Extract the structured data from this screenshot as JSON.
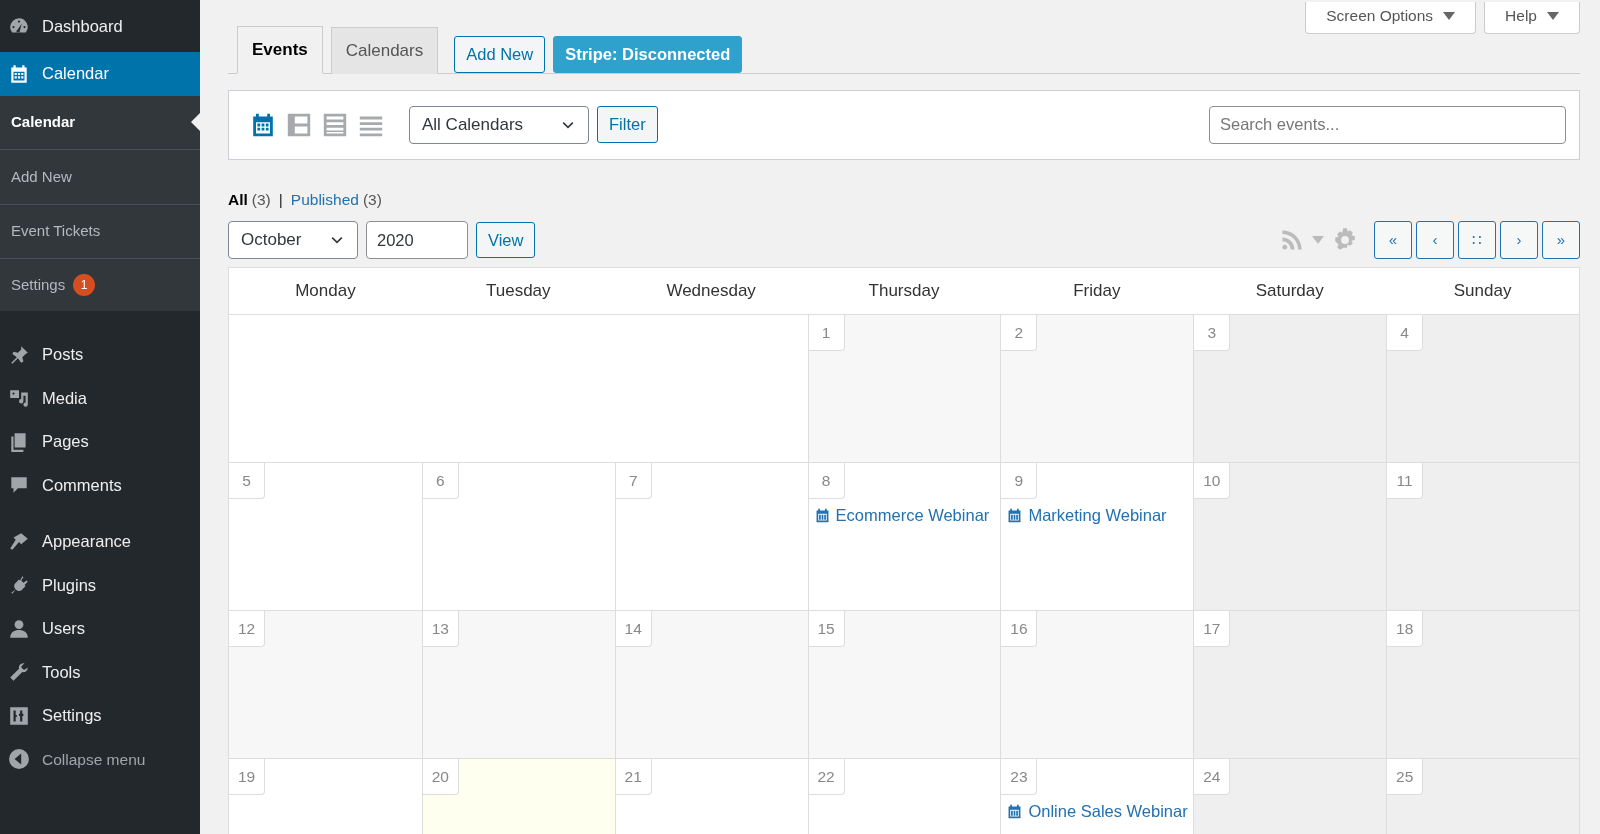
{
  "sidebar": {
    "items": [
      {
        "label": "Dashboard",
        "selected": false
      },
      {
        "label": "Calendar",
        "selected": true,
        "children": [
          {
            "label": "Calendar",
            "selected": true
          },
          {
            "label": "Add New",
            "selected": false
          },
          {
            "label": "Event Tickets",
            "selected": false
          },
          {
            "label": "Settings",
            "selected": false,
            "badge": "1"
          }
        ]
      },
      {
        "label": "Posts",
        "selected": false
      },
      {
        "label": "Media",
        "selected": false
      },
      {
        "label": "Pages",
        "selected": false
      },
      {
        "label": "Comments",
        "selected": false
      },
      {
        "label": "Appearance",
        "selected": false,
        "separator_before": true
      },
      {
        "label": "Plugins",
        "selected": false
      },
      {
        "label": "Users",
        "selected": false
      },
      {
        "label": "Tools",
        "selected": false
      },
      {
        "label": "Settings",
        "selected": false
      }
    ],
    "collapse_label": "Collapse menu"
  },
  "screen_meta": [
    "Screen Options",
    "Help"
  ],
  "tabs": [
    {
      "label": "Events",
      "selected": true
    },
    {
      "label": "Calendars",
      "selected": false
    }
  ],
  "actions": [
    {
      "label": "Add New",
      "kind": "outline"
    },
    {
      "label": "Stripe: Disconnected",
      "kind": "primary"
    }
  ],
  "toolbar": {
    "views": [
      {
        "selected": true
      },
      {
        "selected": false
      },
      {
        "selected": false
      },
      {
        "selected": false
      }
    ],
    "calendar_filter": "All Calendars",
    "filter_button": "Filter",
    "search": {
      "placeholder": "Search events..."
    }
  },
  "status_filters": [
    {
      "label": "All",
      "count": "(3)",
      "selected": true
    },
    {
      "label": "Published",
      "count": "(3)",
      "selected": false
    }
  ],
  "status_separator": "|",
  "period": {
    "month": "October",
    "year": "2020",
    "view_button": "View"
  },
  "nav_buttons": [
    "«",
    "‹",
    "∷",
    "›",
    "»"
  ],
  "calendar": {
    "weekdays": [
      "Monday",
      "Tuesday",
      "Wednesday",
      "Thursday",
      "Friday",
      "Saturday",
      "Sunday"
    ],
    "weeks": [
      {
        "cells": [
          {
            "kind": "blank"
          },
          {
            "kind": "blank"
          },
          {
            "kind": "blank"
          },
          {
            "day": "1",
            "kind": "shaded"
          },
          {
            "day": "2",
            "kind": "shaded"
          },
          {
            "day": "3",
            "kind": "weekend"
          },
          {
            "day": "4",
            "kind": "weekend"
          }
        ]
      },
      {
        "cells": [
          {
            "day": "5",
            "kind": "plain"
          },
          {
            "day": "6",
            "kind": "plain"
          },
          {
            "day": "7",
            "kind": "plain"
          },
          {
            "day": "8",
            "kind": "plain",
            "events": [
              "Ecommerce Webinar"
            ]
          },
          {
            "day": "9",
            "kind": "plain",
            "events": [
              "Marketing Webinar"
            ]
          },
          {
            "day": "10",
            "kind": "weekend"
          },
          {
            "day": "11",
            "kind": "weekend"
          }
        ]
      },
      {
        "cells": [
          {
            "day": "12",
            "kind": "shaded"
          },
          {
            "day": "13",
            "kind": "shaded"
          },
          {
            "day": "14",
            "kind": "shaded"
          },
          {
            "day": "15",
            "kind": "shaded"
          },
          {
            "day": "16",
            "kind": "shaded"
          },
          {
            "day": "17",
            "kind": "weekend"
          },
          {
            "day": "18",
            "kind": "weekend"
          }
        ]
      },
      {
        "cells": [
          {
            "day": "19",
            "kind": "plain"
          },
          {
            "day": "20",
            "kind": "today"
          },
          {
            "day": "21",
            "kind": "plain"
          },
          {
            "day": "22",
            "kind": "plain"
          },
          {
            "day": "23",
            "kind": "plain",
            "events": [
              "Online Sales Webinar"
            ]
          },
          {
            "day": "24",
            "kind": "weekend"
          },
          {
            "day": "25",
            "kind": "weekend"
          }
        ]
      }
    ]
  }
}
